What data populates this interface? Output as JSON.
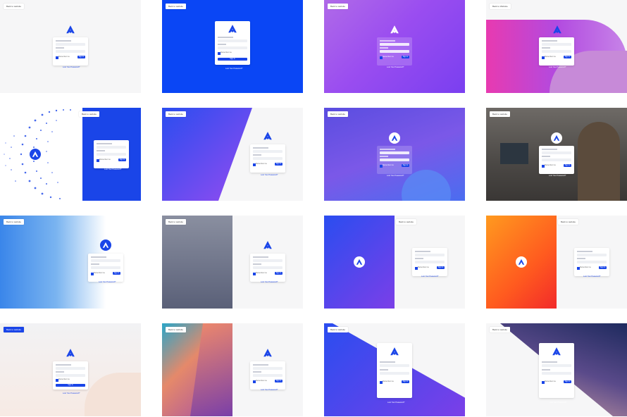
{
  "tiles": [
    {
      "back_label": "Back to website",
      "remember_label": "Remember me",
      "signin_label": "Sign In",
      "forgot_label": "Lost Your Password?"
    },
    {
      "back_label": "Back to website",
      "remember_label": "Remember me",
      "signin_label": "Sign In",
      "forgot_label": "Lost Your Password?"
    },
    {
      "back_label": "Back to website",
      "remember_label": "Remember me",
      "signin_label": "Sign In",
      "forgot_label": "Lost Your Password?"
    },
    {
      "back_label": "Back to Website",
      "remember_label": "Remember me",
      "signin_label": "Sign In",
      "forgot_label": "Lost Your Password?"
    },
    {
      "back_label": "Back to website",
      "remember_label": "Remember me",
      "signin_label": "Sign In",
      "forgot_label": "Lost Your Password?"
    },
    {
      "back_label": "Back to website",
      "remember_label": "Remember me",
      "signin_label": "Sign In",
      "forgot_label": "Lost Your Password?"
    },
    {
      "back_label": "Back to website",
      "remember_label": "Remember me",
      "signin_label": "Sign In",
      "forgot_label": "Lost Your Password?"
    },
    {
      "back_label": "Back to website",
      "remember_label": "Remember me",
      "signin_label": "Sign In",
      "forgot_label": "Lost Your Password?"
    },
    {
      "back_label": "Back to website",
      "remember_label": "Remember me",
      "signin_label": "Sign In",
      "forgot_label": "Lost Your Password?"
    },
    {
      "back_label": "Back to website",
      "remember_label": "Remember me",
      "signin_label": "Sign In",
      "forgot_label": "Lost Your Password?"
    },
    {
      "back_label": "Back to website",
      "remember_label": "Remember me",
      "signin_label": "Sign In",
      "forgot_label": "Lost Your Password?"
    },
    {
      "back_label": "Back to website",
      "remember_label": "Remember me",
      "signin_label": "Sign In",
      "forgot_label": "Lost Your Password?"
    },
    {
      "back_label": "Back to website",
      "remember_label": "Remember me",
      "signin_label": "Sign In",
      "forgot_label": "Lost Your Password?"
    },
    {
      "back_label": "Back to website",
      "remember_label": "Remember me",
      "signin_label": "Sign In",
      "forgot_label": "Lost Your Password?"
    },
    {
      "back_label": "Back to website",
      "remember_label": "Remember me",
      "signin_label": "Sign In",
      "forgot_label": "Lost Your Password?"
    },
    {
      "back_label": "Back to website",
      "remember_label": "Remember me",
      "signin_label": "Sign In",
      "forgot_label": "Lost Your Password?"
    }
  ],
  "icons": {
    "logo": "brand-a-logo-icon"
  },
  "colors": {
    "accent": "#1a45e8",
    "purple": "#8b3ff0",
    "pink": "#e23fb0",
    "orange": "#ff8a1f"
  }
}
